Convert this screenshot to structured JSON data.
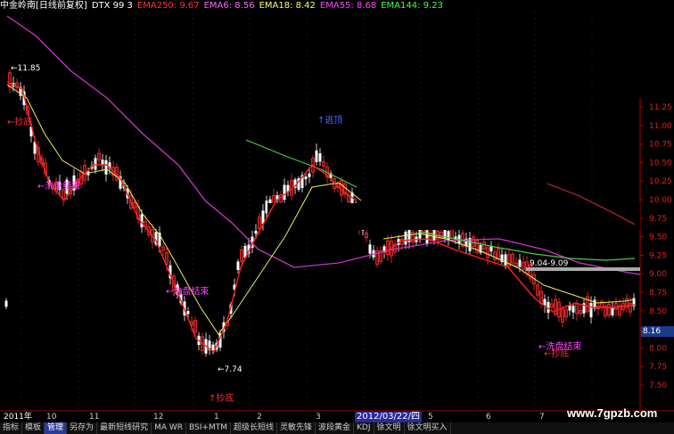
{
  "header": {
    "stock_title": "中金岭南[日线前复权]",
    "dtx": "DTX 99 3",
    "indicators": [
      {
        "label": "EMA250: 9.67",
        "color": "#ff3333"
      },
      {
        "label": "EMA6: 8.56",
        "color": "#ff66ff"
      },
      {
        "label": "EMA18: 8.42",
        "color": "#ffff66"
      },
      {
        "label": "EMA55: 8.68",
        "color": "#ff44ff"
      },
      {
        "label": "EMA144: 9.23",
        "color": "#44ff44"
      }
    ]
  },
  "axis": {
    "ticks": [
      "11.25",
      "11.00",
      "10.75",
      "10.50",
      "10.25",
      "10.00",
      "9.75",
      "9.50",
      "9.25",
      "9.00",
      "8.75",
      "8.50",
      "8.25",
      "8.00",
      "7.75",
      "7.50"
    ],
    "current_price": "8.16",
    "mid_label": "中线"
  },
  "annotations": {
    "high_price": "11.85",
    "low_price": "7.74",
    "range_label": "9.04-9.09",
    "top_label": "逃顶",
    "bottom_label": "抄底",
    "bottom_label2": "抄底",
    "bottom_label3": "抄底",
    "wash_end": "洗盘结束",
    "wash_end2": "洗盘结束",
    "wash_end3": "洗盘结束"
  },
  "datebar": {
    "labels": [
      "2011年",
      "10",
      "11",
      "12",
      "1",
      "2",
      "3",
      "4",
      "5",
      "6",
      "7"
    ],
    "cursor_date": "2012/03/22/四"
  },
  "tabs": [
    {
      "label": "指标",
      "active": false
    },
    {
      "label": "模板",
      "active": false
    },
    {
      "label": "管理",
      "active": true
    },
    {
      "label": "另存为",
      "active": false
    },
    {
      "label": "最新短线研究",
      "active": false
    },
    {
      "label": "MA WR",
      "active": false
    },
    {
      "label": "BSI+MTM",
      "active": false
    },
    {
      "label": "超级长短线",
      "active": false
    },
    {
      "label": "灵敏先锋",
      "active": false
    },
    {
      "label": "波段黄金",
      "active": false
    },
    {
      "label": "KDJ",
      "active": false
    },
    {
      "label": "徐文明",
      "active": false
    },
    {
      "label": "徐文明买入",
      "active": false
    }
  ],
  "watermark": "www.7gpzb.com"
}
